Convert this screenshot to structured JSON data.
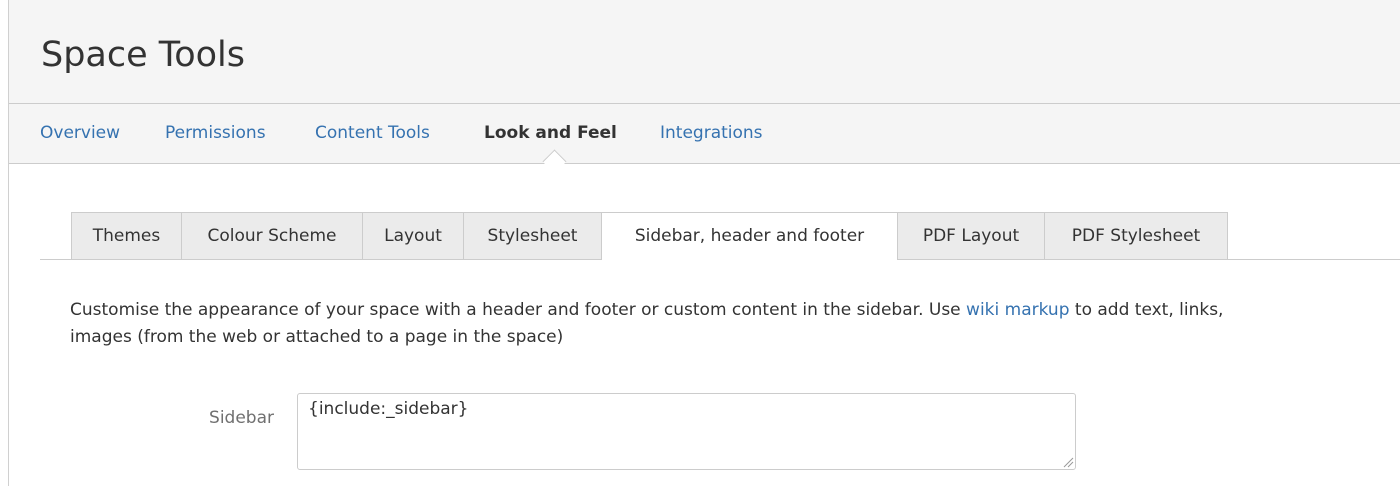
{
  "header": {
    "title": "Space Tools"
  },
  "nav": {
    "items": [
      {
        "label": "Overview",
        "active": false
      },
      {
        "label": "Permissions",
        "active": false
      },
      {
        "label": "Content Tools",
        "active": false
      },
      {
        "label": "Look and Feel",
        "active": true
      },
      {
        "label": "Integrations",
        "active": false
      }
    ]
  },
  "tabs": {
    "items": [
      {
        "label": "Themes",
        "active": false
      },
      {
        "label": "Colour Scheme",
        "active": false
      },
      {
        "label": "Layout",
        "active": false
      },
      {
        "label": "Stylesheet",
        "active": false
      },
      {
        "label": "Sidebar, header and footer",
        "active": true
      },
      {
        "label": "PDF Layout",
        "active": false
      },
      {
        "label": "PDF Stylesheet",
        "active": false
      }
    ]
  },
  "content": {
    "description_before_link": "Customise the appearance of your space with a header and footer or custom content in the sidebar. Use ",
    "description_link": "wiki markup",
    "description_after_link": " to add text, links,",
    "description_line2": "images (from the web or attached to a page in the space)"
  },
  "form": {
    "sidebar_label": "Sidebar",
    "sidebar_value": "{include:_sidebar}"
  },
  "colors": {
    "link": "#3572b0",
    "header_bg": "#f5f5f5",
    "tab_bg": "#ebebeb",
    "border": "#cccccc"
  }
}
